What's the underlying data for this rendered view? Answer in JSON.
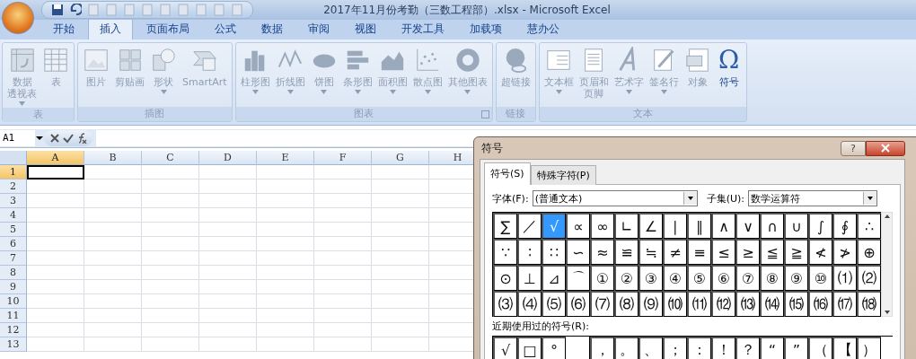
{
  "window": {
    "title": "2017年11月份考勤（三数工程部）.xlsx - Microsoft Excel"
  },
  "tabs": [
    {
      "label": "开始",
      "selected": false
    },
    {
      "label": "插入",
      "selected": true
    },
    {
      "label": "页面布局",
      "selected": false
    },
    {
      "label": "公式",
      "selected": false
    },
    {
      "label": "数据",
      "selected": false
    },
    {
      "label": "审阅",
      "selected": false
    },
    {
      "label": "视图",
      "selected": false
    },
    {
      "label": "开发工具",
      "selected": false
    },
    {
      "label": "加载项",
      "selected": false
    },
    {
      "label": "慧办公",
      "selected": false
    }
  ],
  "ribbon_groups": [
    {
      "label": "表",
      "buttons": [
        {
          "kind": "pivot",
          "label_lines": [
            "数据",
            "透视表"
          ],
          "dropdown": true,
          "disabled": true
        },
        {
          "kind": "table",
          "label": "表",
          "dropdown": false,
          "disabled": true
        }
      ]
    },
    {
      "label": "插图",
      "buttons": [
        {
          "kind": "picture",
          "label": "图片",
          "dropdown": false,
          "disabled": true
        },
        {
          "kind": "clipart",
          "label": "剪贴画",
          "dropdown": false,
          "disabled": true
        },
        {
          "kind": "shapes",
          "label": "形状",
          "dropdown": true,
          "disabled": true
        },
        {
          "kind": "smartart",
          "label": "SmartArt",
          "dropdown": false,
          "disabled": true
        }
      ]
    },
    {
      "label": "图表",
      "launcher": true,
      "buttons": [
        {
          "kind": "column",
          "label": "柱形图",
          "dropdown": true,
          "disabled": true
        },
        {
          "kind": "line",
          "label": "折线图",
          "dropdown": true,
          "disabled": true
        },
        {
          "kind": "pie",
          "label": "饼图",
          "dropdown": true,
          "disabled": true
        },
        {
          "kind": "bar",
          "label": "条形图",
          "dropdown": true,
          "disabled": true
        },
        {
          "kind": "area",
          "label": "面积图",
          "dropdown": true,
          "disabled": true
        },
        {
          "kind": "scatter",
          "label": "散点图",
          "dropdown": true,
          "disabled": true
        },
        {
          "kind": "donut",
          "label": "其他图表",
          "dropdown": true,
          "disabled": true
        }
      ]
    },
    {
      "label": "链接",
      "buttons": [
        {
          "kind": "globe",
          "label": "超链接",
          "dropdown": false,
          "disabled": true
        }
      ]
    },
    {
      "label": "文本",
      "buttons": [
        {
          "kind": "textbox",
          "label": "文本框",
          "dropdown": true,
          "disabled": true
        },
        {
          "kind": "page",
          "label_lines": [
            "页眉和",
            "页脚"
          ],
          "dropdown": false,
          "disabled": true
        },
        {
          "kind": "wordart",
          "label": "艺术字",
          "dropdown": true,
          "disabled": true
        },
        {
          "kind": "pen",
          "label": "签名行",
          "dropdown": true,
          "disabled": true
        },
        {
          "kind": "object",
          "label": "对象",
          "dropdown": false,
          "disabled": true
        },
        {
          "kind": "glyph",
          "glyph": "Ω",
          "label": "符号",
          "dropdown": false,
          "disabled": false
        }
      ]
    }
  ],
  "formula_bar": {
    "name_box": "A1"
  },
  "sheet": {
    "columns": [
      {
        "label": "A",
        "selected": true
      },
      {
        "label": "B",
        "selected": false
      },
      {
        "label": "C",
        "selected": false
      },
      {
        "label": "D",
        "selected": false
      },
      {
        "label": "E",
        "selected": false
      },
      {
        "label": "F",
        "selected": false
      },
      {
        "label": "G",
        "selected": false
      },
      {
        "label": "H",
        "selected": false
      }
    ],
    "rows": [
      {
        "label": "1",
        "selected": true
      },
      {
        "label": "2",
        "selected": false
      },
      {
        "label": "3",
        "selected": false
      },
      {
        "label": "4",
        "selected": false
      },
      {
        "label": "5",
        "selected": false
      },
      {
        "label": "6",
        "selected": false
      },
      {
        "label": "7",
        "selected": false
      },
      {
        "label": "8",
        "selected": false
      },
      {
        "label": "9",
        "selected": false
      },
      {
        "label": "10",
        "selected": false
      },
      {
        "label": "11",
        "selected": false
      },
      {
        "label": "12",
        "selected": false
      },
      {
        "label": "13",
        "selected": false
      }
    ]
  },
  "dialog": {
    "title": "符号",
    "help": "?",
    "tabs": [
      {
        "label": "符号(S)",
        "selected": true
      },
      {
        "label": "特殊字符(P)",
        "selected": false
      }
    ],
    "font_label": "字体(F):",
    "font_value": "(普通文本)",
    "subset_label": "子集(U):",
    "subset_value": "数学运算符",
    "grid": [
      [
        {
          "symbol": "∑",
          "selected": false
        },
        {
          "symbol": "／",
          "selected": false
        },
        {
          "symbol": "√",
          "selected": true
        },
        {
          "symbol": "∝",
          "selected": false
        },
        {
          "symbol": "∞",
          "selected": false
        },
        {
          "symbol": "∟",
          "selected": false
        },
        {
          "symbol": "∠",
          "selected": false
        },
        {
          "symbol": "∣",
          "selected": false
        },
        {
          "symbol": "∥",
          "selected": false
        },
        {
          "symbol": "∧",
          "selected": false
        },
        {
          "symbol": "∨",
          "selected": false
        },
        {
          "symbol": "∩",
          "selected": false
        },
        {
          "symbol": "∪",
          "selected": false
        },
        {
          "symbol": "∫",
          "selected": false
        },
        {
          "symbol": "∮",
          "selected": false
        },
        {
          "symbol": "∴",
          "selected": false
        }
      ],
      [
        {
          "symbol": "∵",
          "selected": false
        },
        {
          "symbol": "∶",
          "selected": false
        },
        {
          "symbol": "∷",
          "selected": false
        },
        {
          "symbol": "∽",
          "selected": false
        },
        {
          "symbol": "≈",
          "selected": false
        },
        {
          "symbol": "≌",
          "selected": false
        },
        {
          "symbol": "≒",
          "selected": false
        },
        {
          "symbol": "≠",
          "selected": false
        },
        {
          "symbol": "≡",
          "selected": false
        },
        {
          "symbol": "≤",
          "selected": false
        },
        {
          "symbol": "≥",
          "selected": false
        },
        {
          "symbol": "≦",
          "selected": false
        },
        {
          "symbol": "≧",
          "selected": false
        },
        {
          "symbol": "≮",
          "selected": false
        },
        {
          "symbol": "≯",
          "selected": false
        },
        {
          "symbol": "⊕",
          "selected": false
        }
      ],
      [
        {
          "symbol": "⊙",
          "selected": false
        },
        {
          "symbol": "⊥",
          "selected": false
        },
        {
          "symbol": "⊿",
          "selected": false
        },
        {
          "symbol": "⌒",
          "selected": false
        },
        {
          "symbol": "①",
          "selected": false
        },
        {
          "symbol": "②",
          "selected": false
        },
        {
          "symbol": "③",
          "selected": false
        },
        {
          "symbol": "④",
          "selected": false
        },
        {
          "symbol": "⑤",
          "selected": false
        },
        {
          "symbol": "⑥",
          "selected": false
        },
        {
          "symbol": "⑦",
          "selected": false
        },
        {
          "symbol": "⑧",
          "selected": false
        },
        {
          "symbol": "⑨",
          "selected": false
        },
        {
          "symbol": "⑩",
          "selected": false
        },
        {
          "symbol": "⑴",
          "selected": false
        },
        {
          "symbol": "⑵",
          "selected": false
        }
      ],
      [
        {
          "symbol": "⑶",
          "selected": false
        },
        {
          "symbol": "⑷",
          "selected": false
        },
        {
          "symbol": "⑸",
          "selected": false
        },
        {
          "symbol": "⑹",
          "selected": false
        },
        {
          "symbol": "⑺",
          "selected": false
        },
        {
          "symbol": "⑻",
          "selected": false
        },
        {
          "symbol": "⑼",
          "selected": false
        },
        {
          "symbol": "⑽",
          "selected": false
        },
        {
          "symbol": "⑾",
          "selected": false
        },
        {
          "symbol": "⑿",
          "selected": false
        },
        {
          "symbol": "⒀",
          "selected": false
        },
        {
          "symbol": "⒁",
          "selected": false
        },
        {
          "symbol": "⒂",
          "selected": false
        },
        {
          "symbol": "⒃",
          "selected": false
        },
        {
          "symbol": "⒄",
          "selected": false
        },
        {
          "symbol": "⒅",
          "selected": false
        }
      ]
    ],
    "recent_label": "近期使用过的符号(R):",
    "recent": [
      {
        "kind": "symbol",
        "symbol": "√"
      },
      {
        "kind": "symbol",
        "symbol": "□"
      },
      {
        "kind": "symbol",
        "symbol": "°"
      },
      {
        "kind": "blank"
      },
      {
        "kind": "symbol",
        "symbol": "，"
      },
      {
        "kind": "symbol",
        "symbol": "。"
      },
      {
        "kind": "symbol",
        "symbol": "、"
      },
      {
        "kind": "symbol",
        "symbol": "；"
      },
      {
        "kind": "symbol",
        "symbol": "："
      },
      {
        "kind": "symbol",
        "symbol": "！"
      },
      {
        "kind": "symbol",
        "symbol": "？"
      },
      {
        "kind": "symbol",
        "symbol": "“"
      },
      {
        "kind": "symbol",
        "symbol": "”"
      },
      {
        "kind": "symbol",
        "symbol": "（"
      },
      {
        "kind": "symbol",
        "symbol": "【"
      },
      {
        "kind": "symbol",
        "symbol": "）"
      }
    ]
  }
}
